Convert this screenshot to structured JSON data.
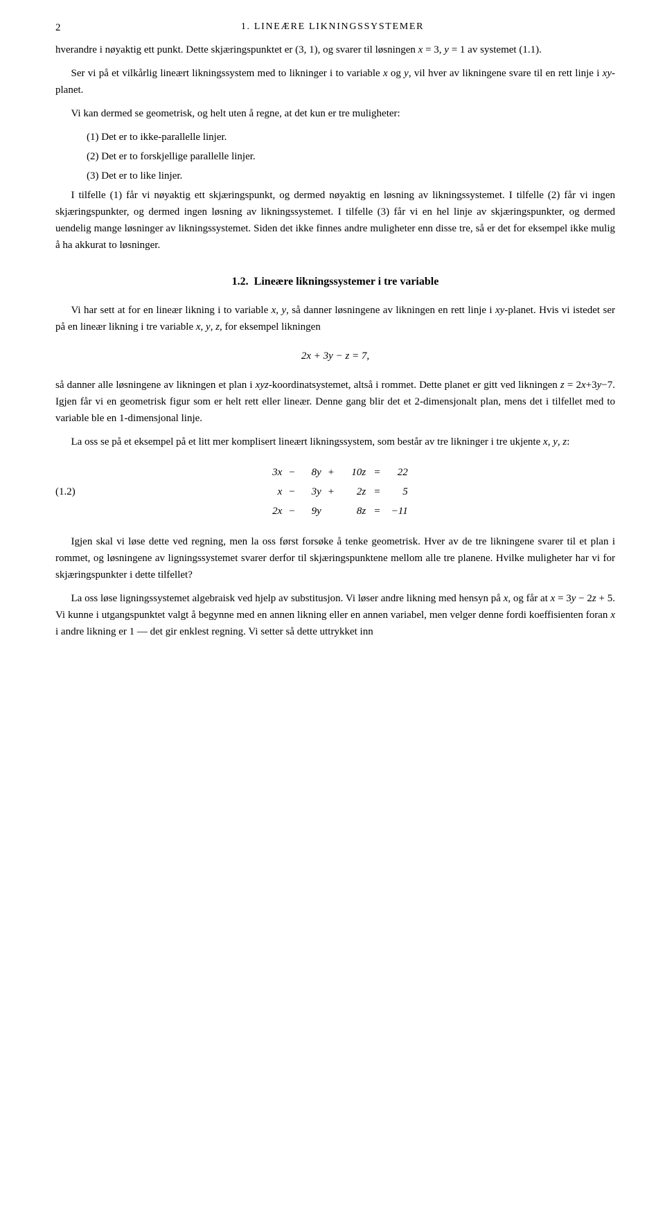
{
  "page": {
    "number": "2",
    "chapter_header": "1. LINEÆRE LIKNINGSSYSTEMER"
  },
  "content": {
    "intro_paragraph": "hverandre i nøyaktig ett punkt. Dette skjæringspunktet er (3, 1), og svarer til løsningen x = 3, y = 1 av systemet (1.1).",
    "paragraph1": "Ser vi på et vilkårlig lineært likningssystem med to likninger i to variable x og y, vil hver av likningene svare til en rett linje i xy-planet.",
    "paragraph2": "Vi kan dermed se geometrisk, og helt uten å regne, at det kun er tre muligheter:",
    "list": [
      "(1) Det er to ikke-parallelle linjer.",
      "(2) Det er to forskjellige parallelle linjer.",
      "(3) Det er to like linjer."
    ],
    "paragraph3": "I tilfelle (1) får vi nøyaktig ett skjæringspunkt, og dermed nøyaktig en løsning av likningssystemet. I tilfelle (2) får vi ingen skjæringspunkter, og dermed ingen løsning av likningssystemet. I tilfelle (3) får vi en hel linje av skjæringspunkter, og dermed uendelig mange løsninger av likningssystemet. Siden det ikke finnes andre muligheter enn disse tre, så er det for eksempel ikke mulig å ha akkurat to løsninger.",
    "section_number": "1.2.",
    "section_title": "Lineære likningssystemer i tre variable",
    "section_paragraph1": "Vi har sett at for en lineær likning i to variable x, y, så danner løsningene av likningen en rett linje i xy-planet. Hvis vi istedet ser på en lineær likning i tre variable x, y, z, for eksempel likningen",
    "equation1": "2x + 3y − z = 7,",
    "section_paragraph2": "så danner alle løsningene av likningen et plan i xyz-koordinatsystemet, altså i rommet. Dette planet er gitt ved likningen z = 2x+3y−7. Igjen får vi en geometrisk figur som er helt rett eller lineær. Denne gang blir det et 2-dimensjonalt plan, mens det i tilfellet med to variable ble en 1-dimensjonal linje.",
    "section_paragraph3": "La oss se på et eksempel på et litt mer komplisert lineært likningssystem, som består av tre likninger i tre ukjente x, y, z:",
    "system_label": "(1.2)",
    "system_rows": [
      {
        "lhs1": "3x",
        "op1": "−",
        "lhs2": "8y",
        "op2": "+",
        "lhs3": "10z",
        "eq": "=",
        "rhs": "22"
      },
      {
        "lhs1": "x",
        "op1": "−",
        "lhs2": "3y",
        "op2": "+",
        "lhs3": "2z",
        "eq": "=",
        "rhs": "5"
      },
      {
        "lhs1": "2x",
        "op1": "−",
        "lhs2": "9y",
        "op2": "",
        "lhs3": "8z",
        "eq": "=",
        "rhs": "−11"
      }
    ],
    "section_paragraph4": "Igjen skal vi løse dette ved regning, men la oss først forsøke å tenke geometrisk. Hver av de tre likningene svarer til et plan i rommet, og løsningene av ligningssystemet svarer derfor til skjæringspunktene mellom alle tre planene. Hvilke muligheter har vi for skjæringspunkter i dette tilfellet?",
    "section_paragraph5": "La oss løse ligningssystemet algebraisk ved hjelp av substitusjon. Vi løser andre likning med hensyn på x, og får at x = 3y − 2z + 5. Vi kunne i utgangspunktet valgt å begynne med en annen likning eller en annen variabel, men velger denne fordi koeffisienten foran x i andre likning er 1 — det gir enklest regning. Vi setter så dette uttrykket inn"
  }
}
